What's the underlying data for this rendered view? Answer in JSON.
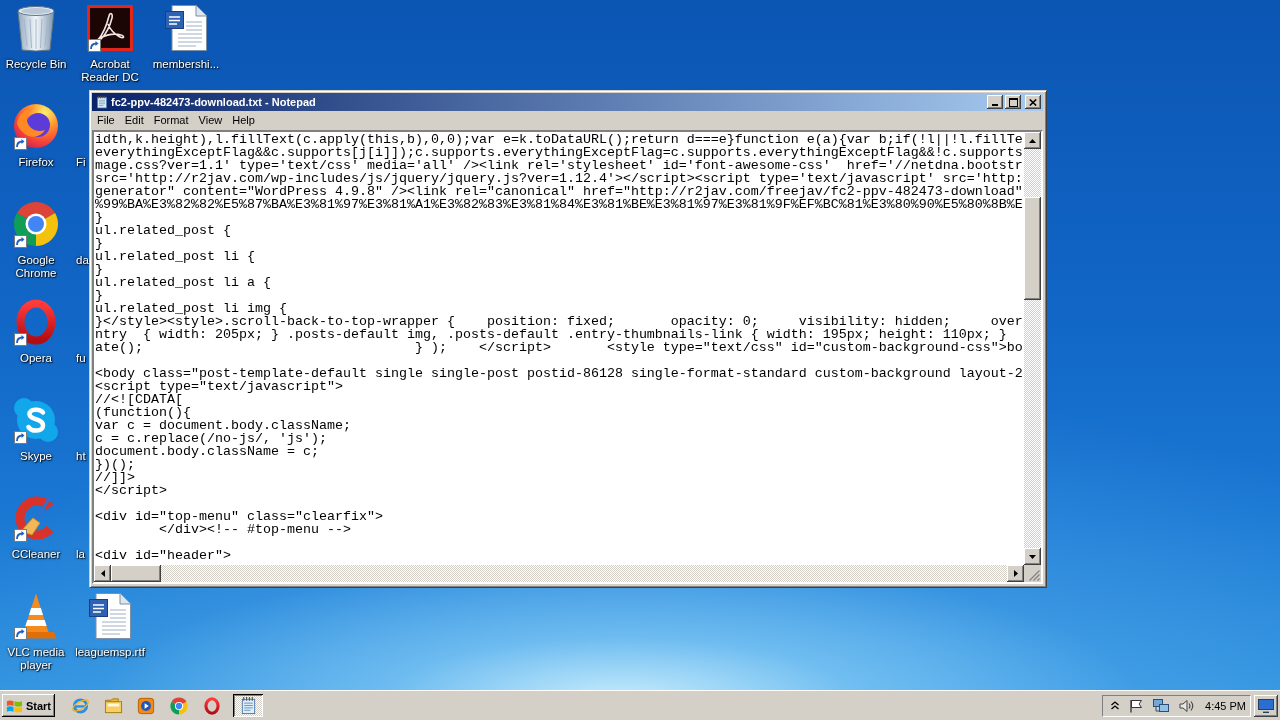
{
  "desktop": {
    "icons": [
      {
        "kind": "recycle-bin",
        "label": "Recycle Bin",
        "shortcut": false
      },
      {
        "kind": "firefox",
        "label": "Firefox",
        "shortcut": true
      },
      {
        "kind": "chrome",
        "label": "Google Chrome",
        "shortcut": true
      },
      {
        "kind": "opera",
        "label": "Opera",
        "shortcut": true
      },
      {
        "kind": "skype",
        "label": "Skype",
        "shortcut": true
      },
      {
        "kind": "ccleaner",
        "label": "CCleaner",
        "shortcut": true
      },
      {
        "kind": "vlc",
        "label": "VLC media player",
        "shortcut": true
      },
      {
        "kind": "pdf-reader",
        "label": "Acrobat Reader DC",
        "shortcut": true
      },
      {
        "kind": "covered",
        "label": "Fi"
      },
      {
        "kind": "covered",
        "label": "da"
      },
      {
        "kind": "covered",
        "label": "fu"
      },
      {
        "kind": "covered",
        "label": "ht"
      },
      {
        "kind": "covered",
        "label": "la"
      },
      {
        "kind": "word-document",
        "label": "leaguemsp.rtf",
        "shortcut": false
      },
      {
        "kind": "word-document",
        "label": "membershi...",
        "shortcut": false
      }
    ]
  },
  "notepad": {
    "title": "fc2-ppv-482473-download.txt - Notepad",
    "menu": [
      "File",
      "Edit",
      "Format",
      "View",
      "Help"
    ],
    "blocks": [
      [
        "idth,k.height),l.fillText(c.apply(this,b),0,0);var e=k.toDataURL();return d===e}function e(a){var b;if(!l||!l.fillTe",
        "everythingExceptFlag&&c.supports[j[i]]);c.supports.everythingExceptFlag=c.supports.everythingExceptFlag&&!c.supports",
        "mage.css?ver=1.1' type='text/css' media='all' /><link rel='stylesheet' id='font-awesome-css'  href='//netdna.bootstr",
        "src='http://r2jav.com/wp-includes/js/jquery/jquery.js?ver=1.12.4'></script><script type='text/javascript' src='http:",
        "generator\" content=\"WordPress 4.9.8\" /><link rel=\"canonical\" href=\"http://r2jav.com/freejav/fc2-ppv-482473-download\"",
        "%99%BA%E3%82%82%E5%87%BA%E3%81%97%E3%81%A1%E3%82%83%E3%81%84%E3%81%BE%E3%81%97%E3%81%9F%EF%BC%81%E3%80%90%E5%80%8B%E",
        "}",
        "ul.related_post {",
        "}",
        "ul.related_post li {",
        "}",
        "ul.related_post li a {",
        "}",
        "ul.related_post li img {",
        "}</style><style>.scroll-back-to-top-wrapper {    position: fixed;       opacity: 0;     visibility: hidden;     over",
        "ntry  { width: 205px; } .posts-default img, .posts-default .entry-thumbnails-link { width: 195px; height: 110px; }",
        "ate();                                  } );    </script>       <style type=\"text/css\" id=\"custom-background-css\">bo"
      ],
      [
        "<body class=\"post-template-default single single-post postid-86128 single-format-standard custom-background layout-2",
        "<script type=\"text/javascript\">",
        "//<![CDATA[",
        "(function(){",
        "var c = document.body.className;",
        "c = c.replace(/no-js/, 'js');",
        "document.body.className = c;",
        "})();",
        "//]]>",
        "</script>"
      ],
      [
        "<div id=\"top-menu\" class=\"clearfix\">",
        "        </div><!-- #top-menu -->"
      ],
      [
        "<div id=\"header\">"
      ]
    ]
  },
  "taskbar": {
    "start_label": "Start",
    "apps": [
      {
        "kind": "internet-explorer",
        "selected": false
      },
      {
        "kind": "file-explorer",
        "selected": false
      },
      {
        "kind": "media-player",
        "selected": false
      },
      {
        "kind": "chrome",
        "selected": false
      },
      {
        "kind": "opera",
        "selected": false
      },
      {
        "kind": "notepad",
        "selected": true
      }
    ],
    "clock": "4:45 PM"
  }
}
